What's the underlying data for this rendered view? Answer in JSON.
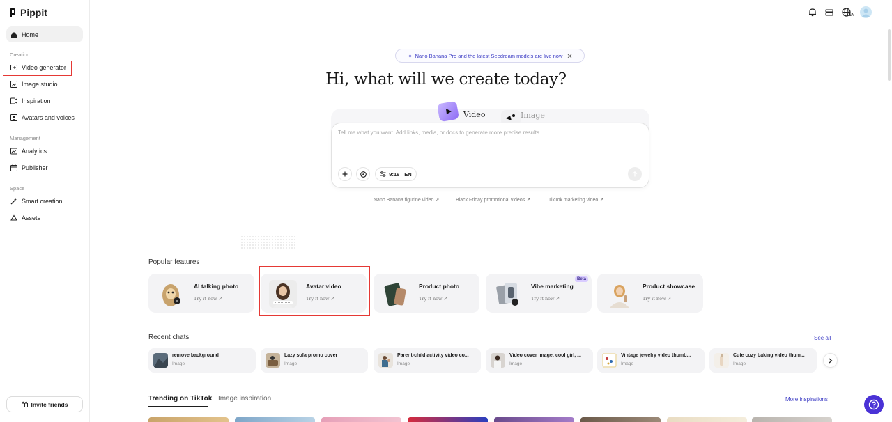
{
  "app": {
    "name": "Pippit"
  },
  "sidebar": {
    "home": "Home",
    "sections": [
      {
        "label": "Creation",
        "items": [
          "Video generator",
          "Image studio",
          "Inspiration",
          "Avatars and voices"
        ]
      },
      {
        "label": "Management",
        "items": [
          "Analytics",
          "Publisher"
        ]
      },
      {
        "label": "Space",
        "items": [
          "Smart creation",
          "Assets"
        ]
      }
    ],
    "invite": "Invite friends"
  },
  "topbar": {
    "lang": "EN",
    "icons": [
      "bell-icon",
      "layers-icon",
      "globe-icon",
      "avatar"
    ]
  },
  "announcement": "Nano Banana Pro and the latest Seedream models are live now",
  "greeting": "Hi, what will we create today?",
  "modes": {
    "video": "Video",
    "image": "Image"
  },
  "prompt": {
    "placeholder": "Tell me what you want. Add links, media, or docs to generate more precise results.",
    "ratio": "9:16",
    "lang": "EN"
  },
  "suggestions": [
    "Nano Banana figurine video",
    "Black Friday promotional videos",
    "TikTok marketing video"
  ],
  "popular": {
    "title": "Popular features",
    "try_label": "Try it now",
    "items": [
      {
        "title": "AI talking photo"
      },
      {
        "title": "Avatar video"
      },
      {
        "title": "Product photo"
      },
      {
        "title": "Vibe marketing",
        "badge": "Beta"
      },
      {
        "title": "Product showcase"
      }
    ]
  },
  "recent": {
    "title": "Recent chats",
    "see_all": "See all",
    "items": [
      {
        "title": "remove background",
        "type": "Image"
      },
      {
        "title": "Lazy sofa promo cover",
        "type": "Image"
      },
      {
        "title": "Parent-child activity video co...",
        "type": "Image"
      },
      {
        "title": "Video cover image: cool girl, ...",
        "type": "Image"
      },
      {
        "title": "Vintage jewelry video thumb...",
        "type": "Image"
      },
      {
        "title": "Cute cozy baking video thum...",
        "type": "Image"
      }
    ]
  },
  "tabs": {
    "trending": "Trending on TikTok",
    "inspiration": "Image inspiration",
    "more": "More inspirations"
  },
  "colors": {
    "accent": "#3b3bc4",
    "highlight": "#e53935",
    "help": "#4a32d6"
  }
}
